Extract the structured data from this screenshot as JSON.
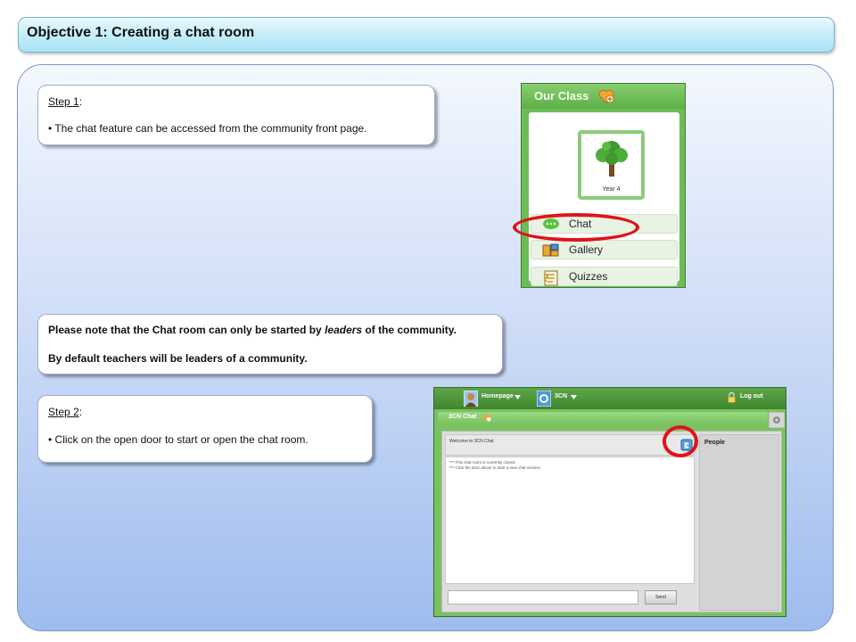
{
  "header": {
    "title": "Objective 1: Creating a chat room"
  },
  "step1": {
    "label": "Step 1",
    "suffix": ":",
    "bullet": "•",
    "text": "The chat feature can be accessed from the community front page."
  },
  "note": {
    "line1_pre": "Please note that the Chat room can only be started by ",
    "line1_em": "leaders",
    "line1_post": " of the community.",
    "line2": "By default teachers will be leaders of a community."
  },
  "step2": {
    "label": "Step 2",
    "suffix": ":",
    "bullet": "•",
    "text": "Click on the open door to start or open the chat room."
  },
  "our_class": {
    "title": "Our Class",
    "image_caption": "Year 4",
    "items": [
      {
        "label": "Chat",
        "icon": "chat-bubble-icon"
      },
      {
        "label": "Gallery",
        "icon": "gallery-icon"
      },
      {
        "label": "Quizzes",
        "icon": "quiz-icon"
      }
    ]
  },
  "chat_window": {
    "nav_home": "Homepage",
    "nav_community": "3CN",
    "logout": "Log out",
    "panel_title": "3CN Chat",
    "welcome": "Welcome to 3CN Chat",
    "messages": [
      "*** This chat room is currently closed",
      "*** Click the door above to start a new chat session"
    ],
    "people_label": "People",
    "send_label": "Send"
  },
  "colors": {
    "highlight_ring": "#e0141b",
    "title_bar": "#c2ecf8",
    "panel": "#cbdaf6",
    "app_green": "#6cbd56"
  }
}
